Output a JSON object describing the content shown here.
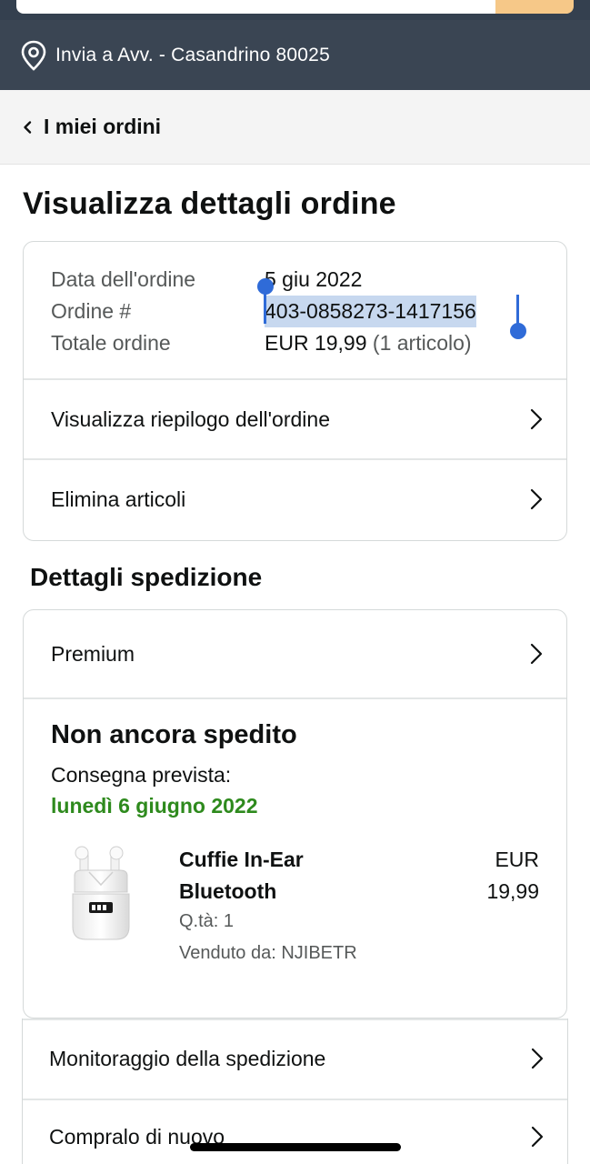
{
  "header": {
    "delivery_location": "Invia a Avv. - Casandrino 80025",
    "location_icon": "location-pin-icon"
  },
  "nav": {
    "back_label": "I miei ordini",
    "back_icon": "chevron-left-icon"
  },
  "page": {
    "title": "Visualizza dettagli ordine"
  },
  "order_summary": {
    "date_label": "Data dell'ordine",
    "date_value": "5 giu 2022",
    "number_label": "Ordine #",
    "number_value": "403-0858273-1417156",
    "total_label": "Totale ordine",
    "total_value": "EUR 19,99",
    "total_items": "(1 articolo)",
    "links": [
      {
        "label": "Visualizza riepilogo dell'ordine"
      },
      {
        "label": "Elimina articoli"
      }
    ]
  },
  "shipping": {
    "section_title": "Dettagli spedizione",
    "method": "Premium",
    "status": "Non ancora spedito",
    "delivery_label": "Consegna prevista:",
    "delivery_date": "lunedì 6 giugno 2022",
    "accent_color": "#2e8a1d",
    "product": {
      "name_line1": "Cuffie In-Ear",
      "name_line2": "Bluetooth",
      "price_line1": "EUR",
      "price_line2": "19,99",
      "quantity": "Q.tà: 1",
      "seller": "Venduto da: NJIBETR",
      "image_icon": "earbuds-case-icon"
    }
  },
  "actions": [
    {
      "label": "Monitoraggio della spedizione"
    },
    {
      "label": "Compralo di nuovo"
    }
  ]
}
